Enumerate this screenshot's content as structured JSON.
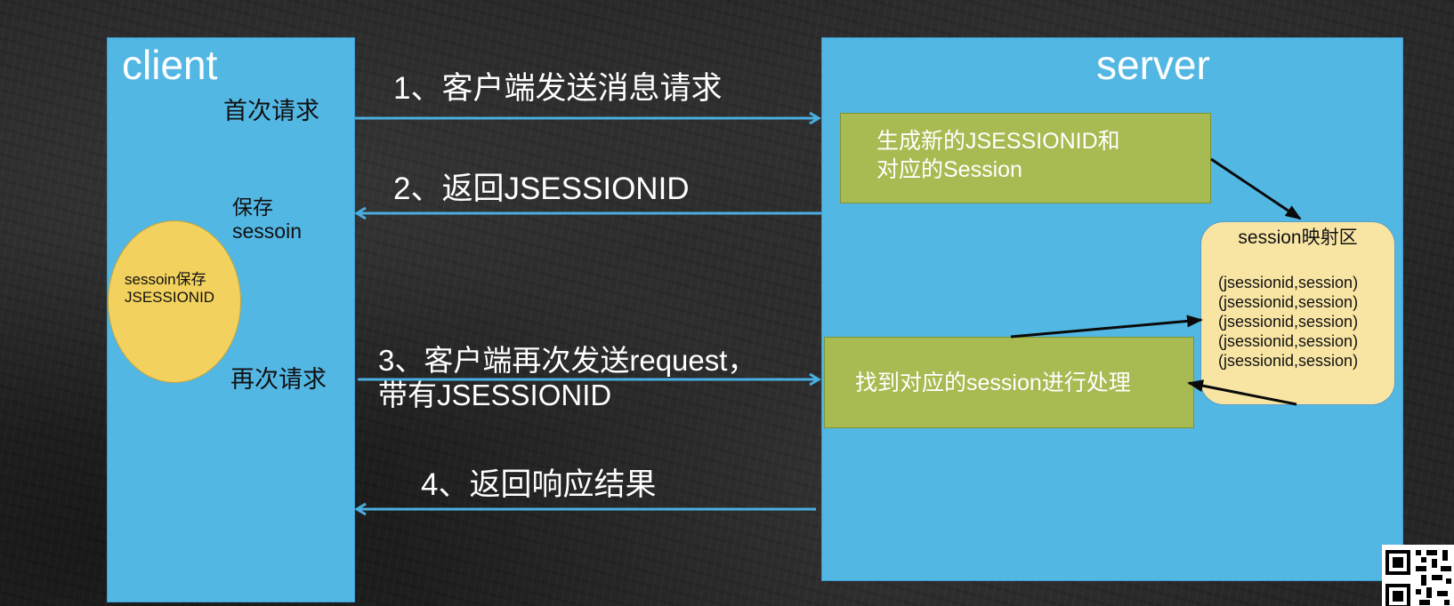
{
  "client": {
    "title": "client",
    "first_request": "首次请求",
    "save_label": {
      "line1": "保存",
      "line2": "sessoin"
    },
    "again_request": "再次请求",
    "storage": {
      "line1": "sessoin保存",
      "line2": "JSESSIONID"
    }
  },
  "server": {
    "title": "server",
    "generate_box": {
      "line1": "生成新的JSESSIONID和",
      "line2": "对应的Session"
    },
    "session_map": {
      "title": "session映射区",
      "entries": [
        "(jsessionid,session)",
        "(jsessionid,session)",
        "(jsessionid,session)",
        "(jsessionid,session)",
        "(jsessionid,session)"
      ]
    },
    "process_box": {
      "text": "找到对应的session进行处理"
    }
  },
  "steps": {
    "step1": "1、客户端发送消息请求",
    "step2": "2、返回JSESSIONID",
    "step3": {
      "line1": "3、客户端再次发送request，",
      "line2": "带有JSESSIONID"
    },
    "step4": "4、返回响应结果"
  },
  "colors": {
    "panel_blue": "#53b7e4",
    "box_green": "#a8bb52",
    "storage_yellow": "#f2d15e",
    "session_map_fill": "#f8e5a4",
    "flow_arrow": "#4aaee0",
    "link_arrow": "#0a0a0a",
    "background": "#262626"
  }
}
